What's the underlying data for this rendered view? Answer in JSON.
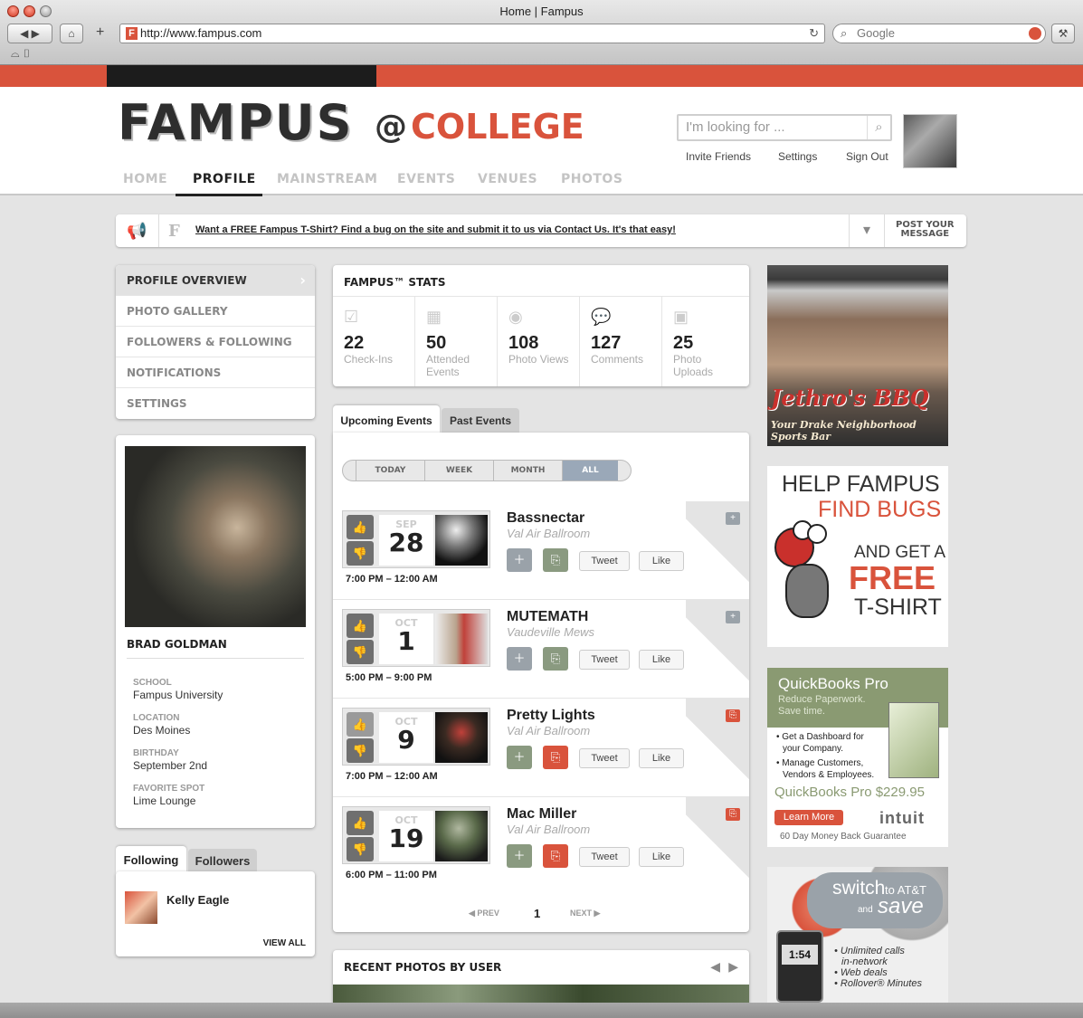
{
  "browser": {
    "title": "Home | Fampus",
    "url": "http://www.fampus.com",
    "search_placeholder": "Google",
    "favicon": "F"
  },
  "site": {
    "logo": "FAMPUS",
    "at": "@",
    "college": "COLLEGE",
    "search_placeholder": "I'm looking for ...",
    "header_links": [
      "Invite Friends",
      "Settings",
      "Sign Out"
    ],
    "nav": [
      "HOME",
      "PROFILE",
      "MAINSTREAM",
      "EVENTS",
      "VENUES",
      "PHOTOS"
    ],
    "active_nav": "PROFILE",
    "accent_color": "#d9533c"
  },
  "announcement": {
    "text": "Want a FREE Fampus T-Shirt? Find a bug on the site and submit it to us via Contact Us. It's that easy!",
    "post_line1": "POST YOUR",
    "post_line2": "MESSAGE"
  },
  "left_menu": [
    "PROFILE OVERVIEW",
    "PHOTO GALLERY",
    "FOLLOWERS & FOLLOWING",
    "NOTIFICATIONS",
    "SETTINGS"
  ],
  "profile": {
    "name": "BRAD GOLDMAN",
    "fields": [
      {
        "label": "SCHOOL",
        "value": "Fampus University"
      },
      {
        "label": "LOCATION",
        "value": "Des Moines"
      },
      {
        "label": "BIRTHDAY",
        "value": "September 2nd"
      },
      {
        "label": "FAVORITE SPOT",
        "value": "Lime Lounge"
      }
    ]
  },
  "follow": {
    "tab_following": "Following",
    "tab_followers": "Followers",
    "people": [
      "Kelly Eagle"
    ],
    "view_all": "VIEW ALL"
  },
  "stats": {
    "title": "FAMPUS™ STATS",
    "items": [
      {
        "num": "22",
        "label": "Check-Ins",
        "icon": "checkbox-icon"
      },
      {
        "num": "50",
        "label": "Attended Events",
        "icon": "calendar-icon"
      },
      {
        "num": "108",
        "label": "Photo Views",
        "icon": "eye-icon"
      },
      {
        "num": "127",
        "label": "Comments",
        "icon": "comment-icon"
      },
      {
        "num": "25",
        "label": "Photo Uploads",
        "icon": "camera-icon"
      }
    ]
  },
  "events": {
    "tab_upcoming": "Upcoming Events",
    "tab_past": "Past Events",
    "filters": [
      "TODAY",
      "WEEK",
      "MONTH",
      "ALL"
    ],
    "active_filter": "ALL",
    "tweet": "Tweet",
    "like": "Like",
    "list": [
      {
        "mon": "SEP",
        "day": "28",
        "name": "Bassnectar",
        "venue": "Val Air Ballroom",
        "time": "7:00 PM – 12:00 AM",
        "checked": false
      },
      {
        "mon": "OCT",
        "day": "1",
        "name": "MUTEMATH",
        "venue": "Vaudeville Mews",
        "time": "5:00 PM – 9:00 PM",
        "checked": false
      },
      {
        "mon": "OCT",
        "day": "9",
        "name": "Pretty Lights",
        "venue": "Val Air Ballroom",
        "time": "7:00 PM – 12:00 AM",
        "checked": true
      },
      {
        "mon": "OCT",
        "day": "19",
        "name": "Mac Miller",
        "venue": "Val Air Ballroom",
        "time": "6:00 PM – 11:00 PM",
        "checked": true
      }
    ],
    "pager": {
      "prev": "PREV",
      "page": "1",
      "next": "NEXT"
    }
  },
  "recent_photos": {
    "title": "RECENT PHOTOS BY USER"
  },
  "ads": {
    "bbq_title": "Jethro's BBQ",
    "bbq_sub": "Your Drake Neighborhood Sports Bar",
    "bugs": [
      "HELP FAMPUS",
      "FIND BUGS",
      "AND GET A",
      "FREE",
      "T-SHIRT"
    ],
    "qb_title": "QuickBooks Pro",
    "qb_tag1": "Reduce Paperwork.",
    "qb_tag2": "Save time.",
    "qb_b1a": "Get a Dashboard for",
    "qb_b1b": "your Company.",
    "qb_b2a": "Manage Customers,",
    "qb_b2b": "Vendors & Employees.",
    "qb_price": "QuickBooks Pro $229.95",
    "qb_learn": "Learn More",
    "qb_brand": "intuit",
    "qb_guarantee": "60 Day Money Back Guarantee",
    "att_l1": "switch",
    "att_l2": "to AT&T",
    "att_l3": "and",
    "att_l4": "save",
    "att_b1": "Unlimited calls",
    "att_b1b": "in-network",
    "att_b2": "Web deals",
    "att_b3": "Rollover® Minutes",
    "att_clock": "1:54"
  }
}
